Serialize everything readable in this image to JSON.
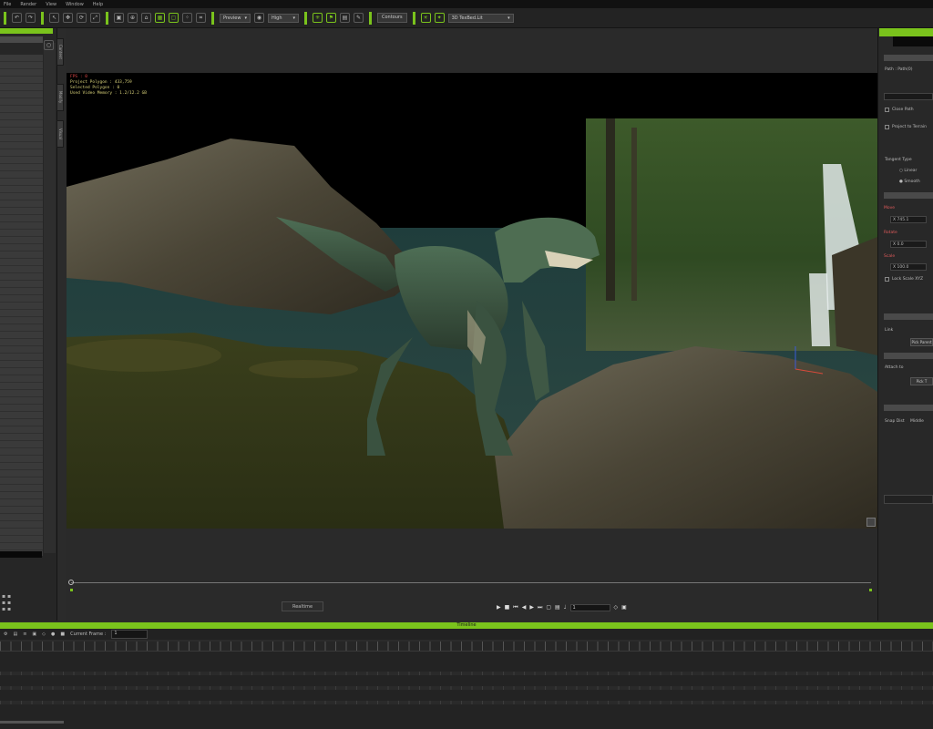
{
  "menu": [
    "File",
    "Render",
    "View",
    "Window",
    "Help"
  ],
  "toolbar": {
    "quality_mode": "Preview",
    "quality_level": "High",
    "contours_label": "Contours",
    "camera": "3D TexBed.Lit",
    "icons": [
      "undo-icon",
      "redo-icon",
      "select-icon",
      "move-icon",
      "rotate-icon",
      "scale-icon",
      "camera-icon",
      "home-icon",
      "grid-icon",
      "dots-icon",
      "snap-icon",
      "light-icon",
      "flag-icon",
      "doc-icon",
      "pen-icon",
      "sun-icon",
      "star-icon"
    ]
  },
  "viewport": {
    "stats": {
      "fps": "FPS : 0",
      "project_polygon": "Project Polygon : 433,759",
      "selected_polygon": "Selected Polygon : 0",
      "video_memory": "Used Video Memory : 1.2/12.2 GB"
    }
  },
  "side_tabs": [
    "Content",
    "Modify",
    "Visual"
  ],
  "playback": {
    "realtime_label": "Realtime",
    "current_frame": "1",
    "controls": [
      "play",
      "stop",
      "prev-key",
      "prev-frame",
      "next-frame",
      "next-key",
      "loop",
      "range",
      "volume"
    ]
  },
  "right_panel": {
    "path_label": "Path : Path(0)",
    "close_path": "Close Path",
    "project_terrain": "Project to Terrain",
    "tangent_type": "Tangent Type",
    "linear": "Linear",
    "smooth": "Smooth",
    "move_label": "Move",
    "rotate_label": "Rotate",
    "scale_label": "Scale",
    "move_x": "X 745.1",
    "rotate_x": "X 0.0",
    "scale_x": "X 100.0",
    "lock_scale": "Lock Scale XYZ",
    "link_label": "Link",
    "pick_parent": "Pick Parent",
    "attach_label": "Attach to",
    "pick_target": "Pick T",
    "snap_label": "Snap Dist",
    "snap_value": "Middle"
  },
  "timeline": {
    "title": "Timeline",
    "current_frame_label": "Current Frame :",
    "current_frame_value": "1"
  }
}
